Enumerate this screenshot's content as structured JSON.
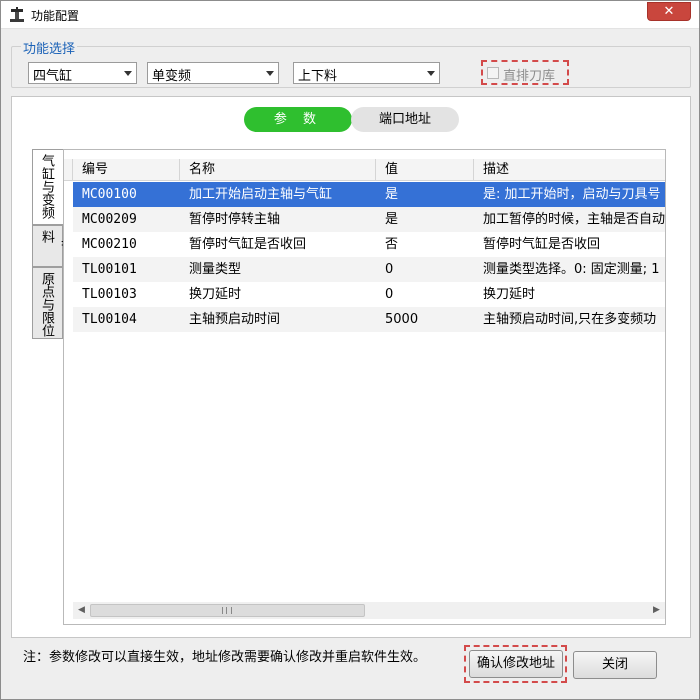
{
  "window": {
    "title": "功能配置",
    "close_label": "✕"
  },
  "function_group": {
    "legend": "功能选择",
    "combos": [
      {
        "value": "四气缸"
      },
      {
        "value": "单变频"
      },
      {
        "value": "上下料"
      }
    ],
    "checkbox": {
      "label": "直排刀库",
      "checked": false
    }
  },
  "segment_tabs": [
    {
      "label": "参 数",
      "active": true
    },
    {
      "label": "端口地址",
      "active": false
    }
  ],
  "side_tabs": [
    {
      "label": "气缸与变频",
      "active": true
    },
    {
      "label": "上下料",
      "active": false
    },
    {
      "label": "原点与限位",
      "active": false
    }
  ],
  "table": {
    "columns": [
      "编号",
      "名称",
      "值",
      "描述"
    ],
    "rows": [
      {
        "id": "MC00100",
        "name": "加工开始启动主轴与气缸",
        "value": "是",
        "desc": "是: 加工开始时，启动与刀具号"
      },
      {
        "id": "MC00209",
        "name": "暂停时停转主轴",
        "value": "是",
        "desc": "加工暂停的时候，主轴是否自动"
      },
      {
        "id": "MC00210",
        "name": "暂停时气缸是否收回",
        "value": "否",
        "desc": "暂停时气缸是否收回"
      },
      {
        "id": "TL00101",
        "name": "测量类型",
        "value": "0",
        "desc": "测量类型选择。0: 固定测量; 1"
      },
      {
        "id": "TL00103",
        "name": "换刀延时",
        "value": "0",
        "desc": "换刀延时"
      },
      {
        "id": "TL00104",
        "name": "主轴预启动时间",
        "value": "5000",
        "desc": "主轴预启动时间,只在多变频功"
      }
    ],
    "selected_row": 0
  },
  "footer": {
    "note": "注：参数修改可以直接生效，地址修改需要确认修改并重启软件生效。",
    "confirm_label": "确认修改地址",
    "close_label": "关闭"
  },
  "colors": {
    "accent_green": "#2fbf2f",
    "selection_blue": "#3571d6",
    "legend_blue": "#1b62b7",
    "highlight_dash": "#d34a4a"
  }
}
